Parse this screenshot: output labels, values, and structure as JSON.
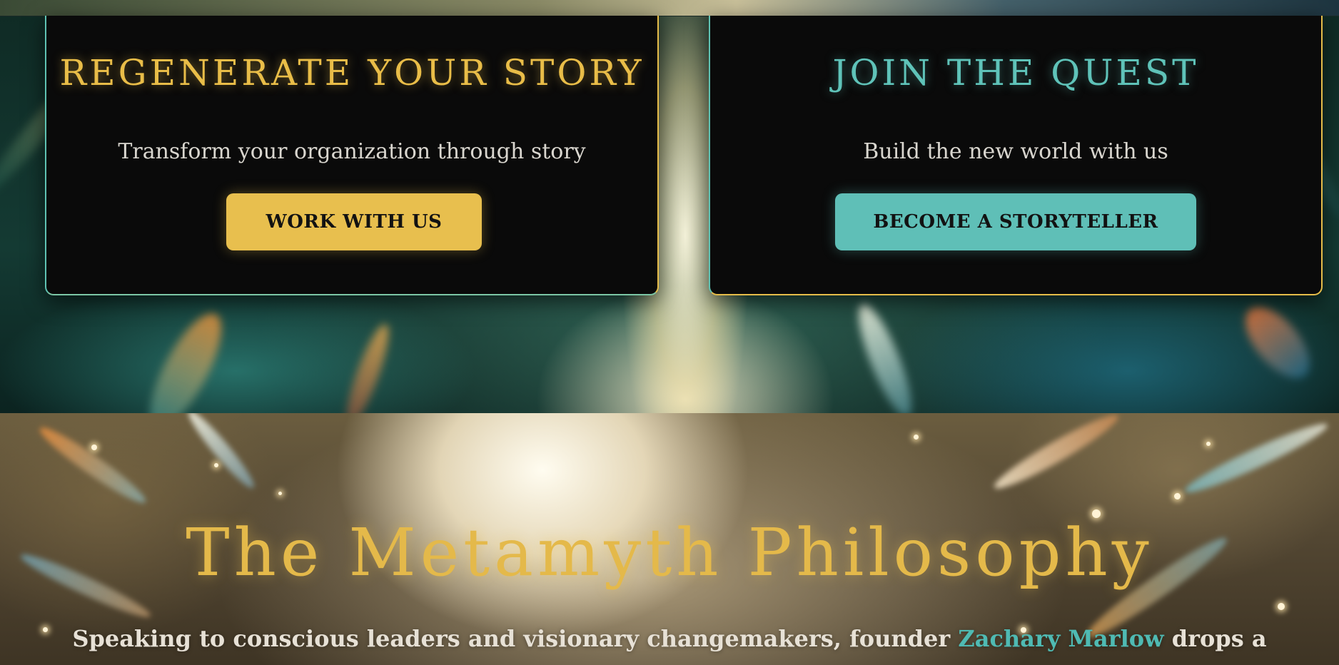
{
  "colors": {
    "gold": "#e9bd48",
    "teal": "#5fc3b9",
    "card_bg": "#0a0a0a",
    "link": "#4fbab3"
  },
  "cards": [
    {
      "title": "Regenerate Your Story",
      "subtitle": "Transform your organization through story",
      "button_label": "WORK WITH US",
      "accent": "gold"
    },
    {
      "title": "Join the Quest",
      "subtitle": "Build the new world with us",
      "button_label": "BECOME A STORYTELLER",
      "accent": "teal"
    }
  ],
  "philosophy": {
    "title": "The Metamyth Philosophy",
    "intro_before_link": "Speaking to conscious leaders and visionary changemakers, founder ",
    "founder_link": "Zachary Marlow",
    "intro_after_link": " drops a"
  }
}
